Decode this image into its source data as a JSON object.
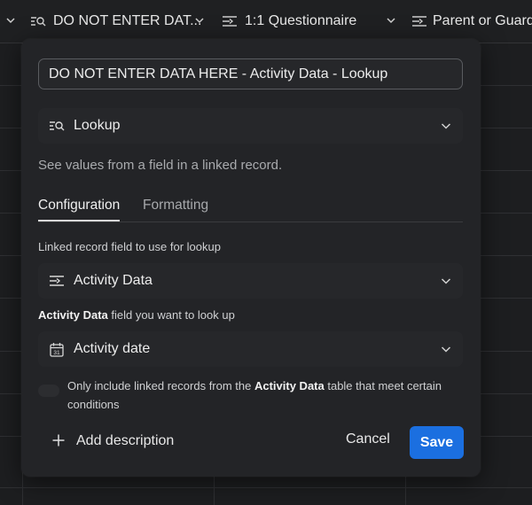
{
  "columns": [
    {
      "label": "DO NOT ENTER DAT...",
      "icon": "lookup-icon"
    },
    {
      "label": "1:1 Questionnaire",
      "icon": "linked-record-icon"
    },
    {
      "label": "Parent or Guardi",
      "icon": "linked-record-icon"
    }
  ],
  "dialog": {
    "field_name": "DO NOT ENTER DATA HERE - Activity Data - Lookup",
    "field_type": {
      "label": "Lookup",
      "icon": "lookup-icon"
    },
    "field_type_description": "See values from a field in a linked record.",
    "tabs": [
      {
        "label": "Configuration",
        "active": true
      },
      {
        "label": "Formatting",
        "active": false
      }
    ],
    "linked_record_label": "Linked record field to use for lookup",
    "linked_record_field": {
      "label": "Activity Data",
      "icon": "linked-record-icon"
    },
    "lookup_label_bold": "Activity Data",
    "lookup_label_rest": " field you want to look up",
    "lookup_field": {
      "label": "Activity date",
      "icon": "calendar-icon",
      "calendar_day": "31"
    },
    "condition_text_1": "Only include linked records from the ",
    "condition_text_bold": "Activity Data",
    "condition_text_2": " table that meet certain conditions",
    "add_description_label": "Add description",
    "cancel_label": "Cancel",
    "save_label": "Save"
  },
  "colors": {
    "accent": "#1b6fe0",
    "background": "#1d1e20",
    "dialog": "#232427"
  }
}
